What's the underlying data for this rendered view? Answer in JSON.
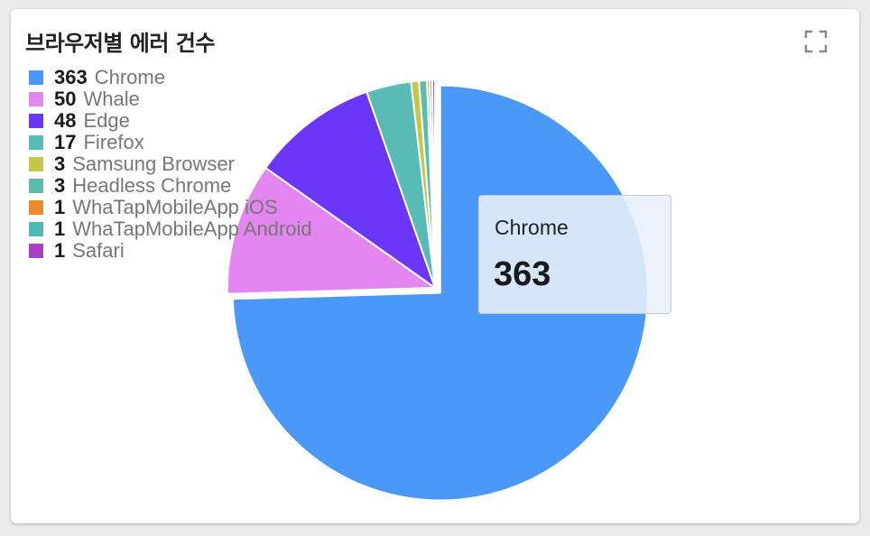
{
  "title": "브라우저별 에러 건수",
  "chart_data": {
    "type": "pie",
    "title": "브라우저별 에러 건수",
    "legend_position": "top-left",
    "slices": [
      {
        "name": "Chrome",
        "value": 363,
        "color": "#4a98f7"
      },
      {
        "name": "Whale",
        "value": 50,
        "color": "#e386f0"
      },
      {
        "name": "Edge",
        "value": 48,
        "color": "#6a36f7"
      },
      {
        "name": "Firefox",
        "value": 17,
        "color": "#58bbb5"
      },
      {
        "name": "Samsung Browser",
        "value": 3,
        "color": "#c3c848"
      },
      {
        "name": "Headless Chrome",
        "value": 3,
        "color": "#5cbcac"
      },
      {
        "name": "WhaTapMobileApp iOS",
        "value": 1,
        "color": "#f08a2f"
      },
      {
        "name": "WhaTapMobileApp Android",
        "value": 1,
        "color": "#4fb8b2"
      },
      {
        "name": "Safari",
        "value": 1,
        "color": "#a93fc1"
      }
    ],
    "highlighted": "Chrome"
  },
  "tooltip": {
    "name": "Chrome",
    "value": "363"
  },
  "icons": {
    "expand": "expand-icon"
  }
}
